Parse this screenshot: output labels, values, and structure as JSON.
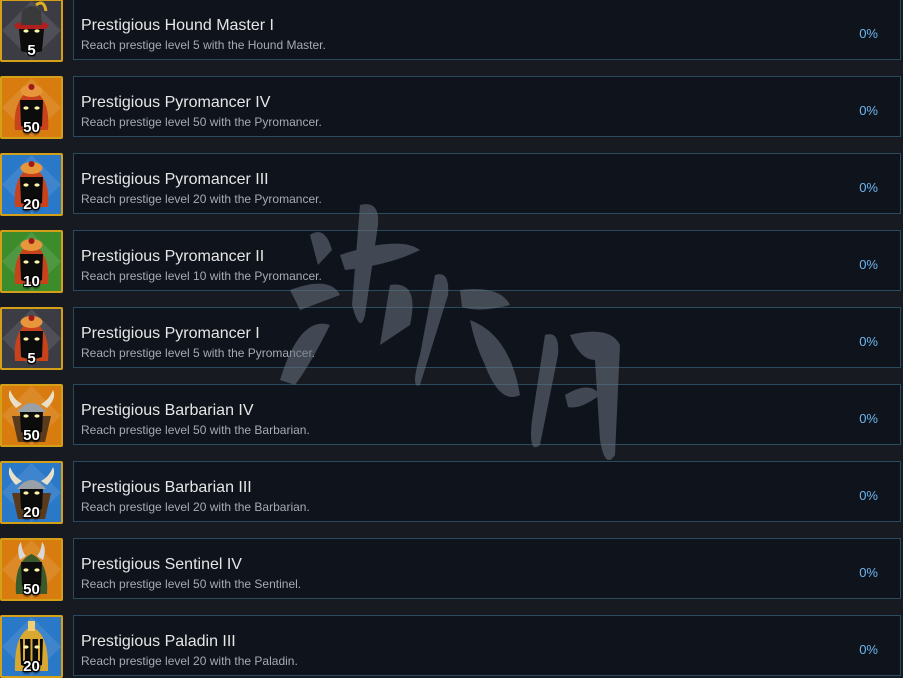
{
  "colors": {
    "accent_gold": "#d4a018",
    "percent_blue": "#6eb6f2",
    "card_border": "#2a4a5e"
  },
  "achievements": [
    {
      "title": "Prestigious Hound Master I",
      "description": "Reach prestige level 5 with the Hound Master.",
      "percent": "0%",
      "badge_level": "5",
      "badge_bg": "#3c3c44",
      "hero": "hound-master",
      "icon_name": "hound-master-icon"
    },
    {
      "title": "Prestigious Pyromancer IV",
      "description": "Reach prestige level 50 with the Pyromancer.",
      "percent": "0%",
      "badge_level": "50",
      "badge_bg": "#d87c10",
      "hero": "pyromancer",
      "icon_name": "pyromancer-icon"
    },
    {
      "title": "Prestigious Pyromancer III",
      "description": "Reach prestige level 20 with the Pyromancer.",
      "percent": "0%",
      "badge_level": "20",
      "badge_bg": "#2a78c8",
      "hero": "pyromancer",
      "icon_name": "pyromancer-icon"
    },
    {
      "title": "Prestigious Pyromancer II",
      "description": "Reach prestige level 10 with the Pyromancer.",
      "percent": "0%",
      "badge_level": "10",
      "badge_bg": "#3c8c2c",
      "hero": "pyromancer",
      "icon_name": "pyromancer-icon"
    },
    {
      "title": "Prestigious Pyromancer I",
      "description": "Reach prestige level 5 with the Pyromancer.",
      "percent": "0%",
      "badge_level": "5",
      "badge_bg": "#3c3c44",
      "hero": "pyromancer",
      "icon_name": "pyromancer-icon"
    },
    {
      "title": "Prestigious Barbarian IV",
      "description": "Reach prestige level 50 with the Barbarian.",
      "percent": "0%",
      "badge_level": "50",
      "badge_bg": "#d87c10",
      "hero": "barbarian",
      "icon_name": "barbarian-icon"
    },
    {
      "title": "Prestigious Barbarian III",
      "description": "Reach prestige level 20 with the Barbarian.",
      "percent": "0%",
      "badge_level": "20",
      "badge_bg": "#2a78c8",
      "hero": "barbarian",
      "icon_name": "barbarian-icon"
    },
    {
      "title": "Prestigious Sentinel IV",
      "description": "Reach prestige level 50 with the Sentinel.",
      "percent": "0%",
      "badge_level": "50",
      "badge_bg": "#d87c10",
      "hero": "sentinel",
      "icon_name": "sentinel-icon"
    },
    {
      "title": "Prestigious Paladin III",
      "description": "Reach prestige level 20 with the Paladin.",
      "percent": "0%",
      "badge_level": "20",
      "badge_bg": "#2a78c8",
      "hero": "paladin",
      "icon_name": "paladin-icon"
    }
  ]
}
